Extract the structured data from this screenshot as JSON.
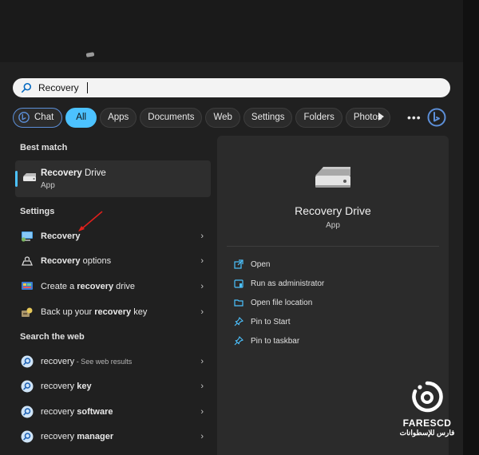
{
  "search": {
    "value": "Recovery"
  },
  "filters": {
    "chat": "Chat",
    "all": "All",
    "apps": "Apps",
    "documents": "Documents",
    "web": "Web",
    "settings": "Settings",
    "folders": "Folders",
    "photos": "Photos"
  },
  "left": {
    "best_match_heading": "Best match",
    "best_match": {
      "title_bold": "Recovery",
      "title_rest": " Drive",
      "subtitle": "App"
    },
    "settings_heading": "Settings",
    "settings_items": [
      {
        "pre": "",
        "bold": "Recovery",
        "post": ""
      },
      {
        "pre": "",
        "bold": "Recovery",
        "post": " options"
      },
      {
        "pre": "Create a ",
        "bold": "recovery",
        "post": " drive"
      },
      {
        "pre": "Back up your ",
        "bold": "recovery",
        "post": " key"
      }
    ],
    "web_heading": "Search the web",
    "web_items": [
      {
        "pre": "recovery",
        "bold": "",
        "muted": " - See web results"
      },
      {
        "pre": "recovery ",
        "bold": "key",
        "muted": ""
      },
      {
        "pre": "recovery ",
        "bold": "software",
        "muted": ""
      },
      {
        "pre": "recovery ",
        "bold": "manager",
        "muted": ""
      }
    ]
  },
  "detail": {
    "title": "Recovery Drive",
    "subtitle": "App",
    "actions": [
      "Open",
      "Run as administrator",
      "Open file location",
      "Pin to Start",
      "Pin to taskbar"
    ]
  },
  "watermark": {
    "brand": "FARESCD",
    "arabic": "فارس للإسطوانات"
  },
  "colors": {
    "accent": "#4cc2ff",
    "annotation_arrow": "#e0201c"
  }
}
